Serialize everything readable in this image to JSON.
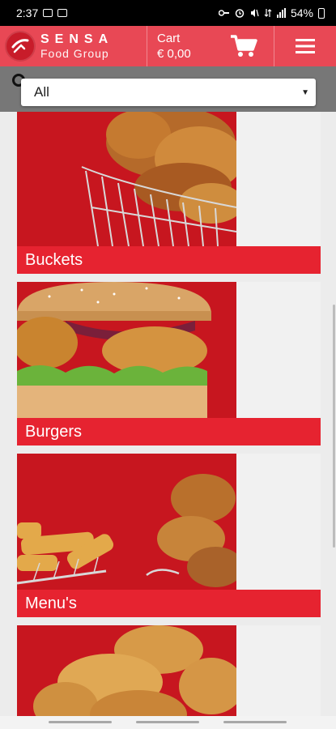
{
  "status": {
    "time": "2:37",
    "battery": "54%"
  },
  "header": {
    "brand": "SENSA",
    "sub": "Food Group",
    "cart_label": "Cart",
    "cart_total": "€ 0,00"
  },
  "filter": {
    "selected": "All"
  },
  "categories": [
    {
      "label": "Buckets"
    },
    {
      "label": "Burgers"
    },
    {
      "label": "Menu's"
    }
  ],
  "colors": {
    "header": "#e84855",
    "accent": "#e62330",
    "image_bg": "#c7161f"
  },
  "icons": [
    "logo-icon",
    "cart-icon",
    "hamburger-menu-icon",
    "search-icon",
    "chevron-down-icon"
  ]
}
